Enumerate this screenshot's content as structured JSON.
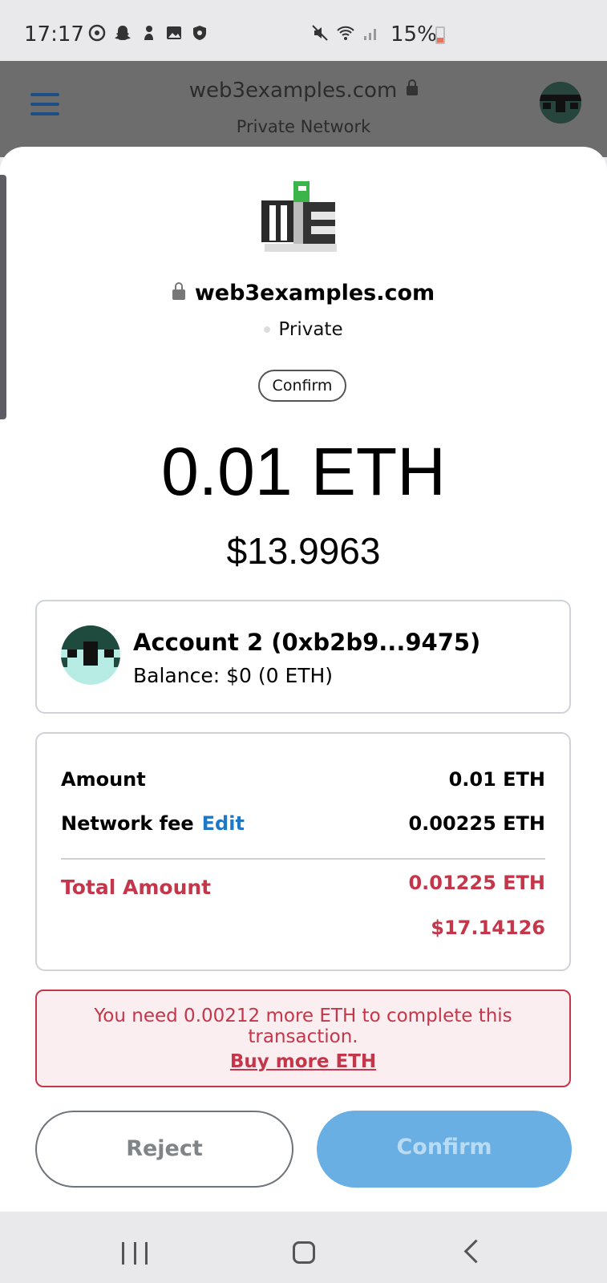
{
  "status_bar": {
    "time": "17:17",
    "battery": "15%",
    "left_icons": [
      "dnd-icon",
      "snapchat-icon",
      "notification-icon",
      "gallery-icon",
      "shield-icon"
    ],
    "right_icons": [
      "mute-icon",
      "wifi-icon",
      "signal-icon",
      "battery-icon"
    ]
  },
  "browser": {
    "url": "web3examples.com",
    "network": "Private Network"
  },
  "request": {
    "site": "web3examples.com",
    "network": "Private",
    "badge": "Confirm",
    "amount": "0.01 ETH",
    "fiat": "$13.9963"
  },
  "account": {
    "name": "Account 2 (0xb2b9...9475)",
    "balance": "Balance: $0 (0 ETH)"
  },
  "fees": {
    "amount_label": "Amount",
    "amount_value": "0.01 ETH",
    "network_fee_label": "Network fee",
    "edit_label": "Edit",
    "network_fee_value": "0.00225 ETH",
    "total_label": "Total Amount",
    "total_eth": "0.01225 ETH",
    "total_fiat": "$17.14126"
  },
  "alert": {
    "message": "You need 0.00212 more ETH to complete this transaction.",
    "link": "Buy more ETH"
  },
  "buttons": {
    "reject": "Reject",
    "confirm": "Confirm"
  },
  "colors": {
    "accent_blue": "#1f78c6",
    "error_red": "#c4364a",
    "confirm_disabled": "#6aafe3"
  }
}
